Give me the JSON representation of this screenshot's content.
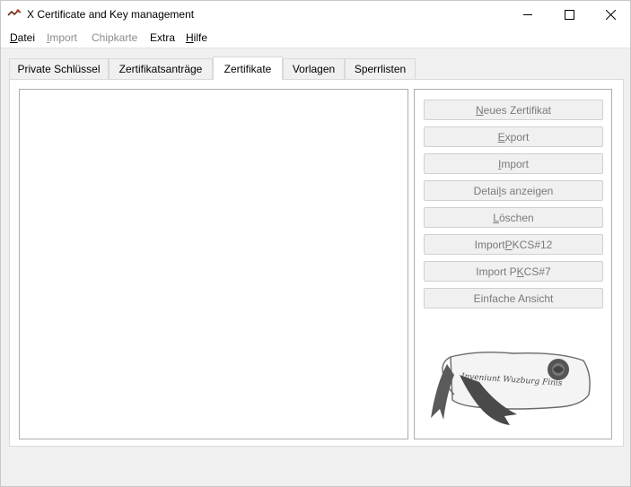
{
  "window": {
    "title": "X Certificate and Key management",
    "icon": "xca-app-icon"
  },
  "menu": [
    {
      "pre": "",
      "mnemonic": "D",
      "post": "atei",
      "disabled": false
    },
    {
      "pre": "",
      "mnemonic": "I",
      "post": "mport",
      "disabled": true
    },
    {
      "pre": "Chipkarte",
      "mnemonic": "",
      "post": "",
      "disabled": true
    },
    {
      "pre": "Extra",
      "mnemonic": "",
      "post": "",
      "disabled": false
    },
    {
      "pre": "",
      "mnemonic": "H",
      "post": "ilfe",
      "disabled": false
    }
  ],
  "tabs": [
    "Private Schlüssel",
    "Zertifikatsanträge",
    "Zertifikate",
    "Vorlagen",
    "Sperrlisten"
  ],
  "active_tab": "Zertifikate",
  "buttons": [
    {
      "pre": "",
      "mnemonic": "N",
      "post": "eues Zertifikat"
    },
    {
      "pre": "",
      "mnemonic": "E",
      "post": "xport"
    },
    {
      "pre": "",
      "mnemonic": "I",
      "post": "mport"
    },
    {
      "pre": "Detai",
      "mnemonic": "l",
      "post": "s anzeigen"
    },
    {
      "pre": "",
      "mnemonic": "L",
      "post": "öschen"
    },
    {
      "pre": "Import ",
      "mnemonic": "P",
      "post": "KCS#12"
    },
    {
      "pre": "Import P",
      "mnemonic": "K",
      "post": "CS#7"
    },
    {
      "pre": "Einfache Ansicht",
      "mnemonic": "",
      "post": ""
    }
  ],
  "seal_text": "Inveniunt Wuzburg Finis",
  "icons": {
    "minimize": "minimize-icon",
    "maximize": "maximize-icon",
    "close": "close-icon",
    "decoration": "scroll-seal-decoration"
  }
}
